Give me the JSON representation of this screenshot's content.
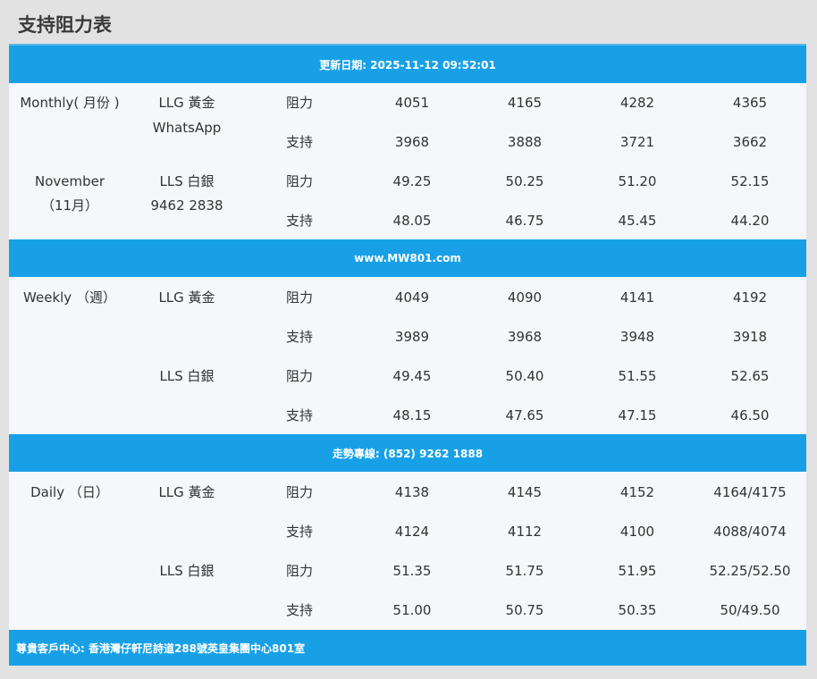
{
  "title": "支持阻力表",
  "update_bar": "更新日期: 2025-11-12 09:52:01",
  "website_bar": "www.MW801.com",
  "hotline_bar": "走勢專線: (852) 9262 1888",
  "footer_bar": "尊貴客戶中心: 香港灣仔軒尼詩道288號英皇集團中心801室",
  "sections": [
    {
      "period_line1": "Monthly( 月份 )",
      "period_line2": "November",
      "period_line3": "（11月）",
      "contact_line1": "WhatsApp",
      "contact_line2": "9462 2838",
      "groups": [
        {
          "instrument": "LLG 黃金",
          "rows": [
            {
              "type": "阻力",
              "values": [
                "4051",
                "4165",
                "4282",
                "4365"
              ]
            },
            {
              "type": "支持",
              "values": [
                "3968",
                "3888",
                "3721",
                "3662"
              ]
            }
          ]
        },
        {
          "instrument": "LLS 白銀",
          "rows": [
            {
              "type": "阻力",
              "values": [
                "49.25",
                "50.25",
                "51.20",
                "52.15"
              ]
            },
            {
              "type": "支持",
              "values": [
                "48.05",
                "46.75",
                "45.45",
                "44.20"
              ]
            }
          ]
        }
      ]
    },
    {
      "period_line1": "Weekly （週）",
      "groups": [
        {
          "instrument": "LLG 黃金",
          "rows": [
            {
              "type": "阻力",
              "values": [
                "4049",
                "4090",
                "4141",
                "4192"
              ]
            },
            {
              "type": "支持",
              "values": [
                "3989",
                "3968",
                "3948",
                "3918"
              ]
            }
          ]
        },
        {
          "instrument": "LLS 白銀",
          "rows": [
            {
              "type": "阻力",
              "values": [
                "49.45",
                "50.40",
                "51.55",
                "52.65"
              ]
            },
            {
              "type": "支持",
              "values": [
                "48.15",
                "47.65",
                "47.15",
                "46.50"
              ]
            }
          ]
        }
      ]
    },
    {
      "period_line1": "Daily （日）",
      "groups": [
        {
          "instrument": "LLG 黃金",
          "rows": [
            {
              "type": "阻力",
              "values": [
                "4138",
                "4145",
                "4152",
                "4164/4175"
              ]
            },
            {
              "type": "支持",
              "values": [
                "4124",
                "4112",
                "4100",
                "4088/4074"
              ]
            }
          ]
        },
        {
          "instrument": "LLS 白銀",
          "rows": [
            {
              "type": "阻力",
              "values": [
                "51.35",
                "51.75",
                "51.95",
                "52.25/52.50"
              ]
            },
            {
              "type": "支持",
              "values": [
                "51.00",
                "50.75",
                "50.35",
                "50/49.50"
              ]
            }
          ]
        }
      ]
    }
  ]
}
